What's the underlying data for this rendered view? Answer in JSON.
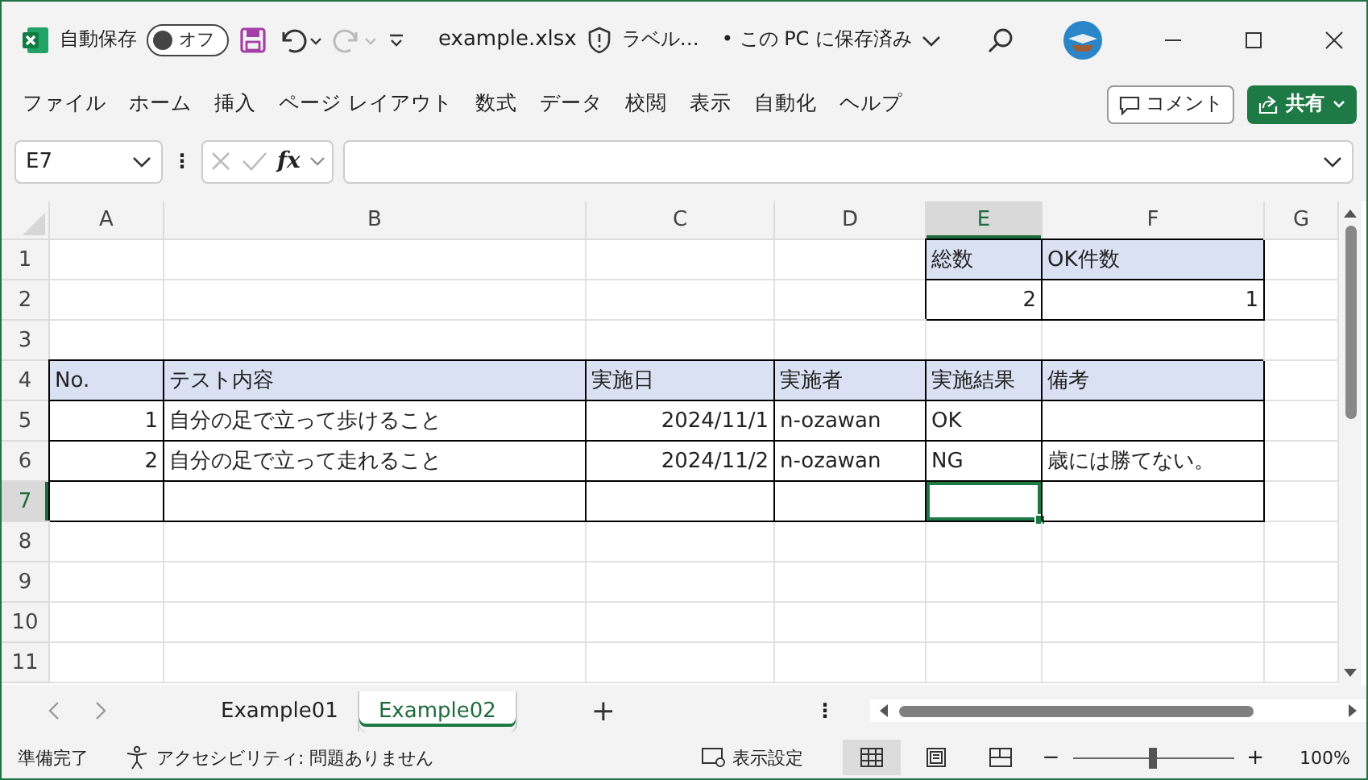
{
  "title_bar": {
    "autosave_label": "自動保存",
    "autosave": {
      "on": false,
      "label": "オフ"
    },
    "file_name": "example.xlsx",
    "label_text": "ラベル…",
    "save_state": "• この PC に保存済み"
  },
  "ribbon": {
    "tabs": [
      "ファイル",
      "ホーム",
      "挿入",
      "ページ レイアウト",
      "数式",
      "データ",
      "校閲",
      "表示",
      "自動化",
      "ヘルプ"
    ],
    "comment_button": "コメント",
    "share_button": "共有"
  },
  "formula_bar": {
    "name_box": "E7",
    "more": "⋮",
    "fx": "fx"
  },
  "columns": [
    {
      "label": "A",
      "selected": false
    },
    {
      "label": "B",
      "selected": false
    },
    {
      "label": "C",
      "selected": false
    },
    {
      "label": "D",
      "selected": false
    },
    {
      "label": "E",
      "selected": true
    },
    {
      "label": "F",
      "selected": false
    },
    {
      "label": "G",
      "selected": false
    }
  ],
  "rows": [
    {
      "label": "1",
      "selected": false,
      "cells": [
        {
          "kind": "blank"
        },
        {
          "kind": "blank"
        },
        {
          "kind": "blank"
        },
        {
          "kind": "blank"
        },
        {
          "kind": "header",
          "text": "総数"
        },
        {
          "kind": "header",
          "text": "OK件数"
        },
        {
          "kind": "blank"
        }
      ]
    },
    {
      "label": "2",
      "selected": false,
      "cells": [
        {
          "kind": "blank"
        },
        {
          "kind": "blank"
        },
        {
          "kind": "blank"
        },
        {
          "kind": "blank"
        },
        {
          "kind": "number",
          "text": "2"
        },
        {
          "kind": "number",
          "text": "1"
        },
        {
          "kind": "blank"
        }
      ]
    },
    {
      "label": "3",
      "selected": false
    },
    {
      "label": "4",
      "selected": false,
      "cells": [
        {
          "kind": "header",
          "text": "No."
        },
        {
          "kind": "header",
          "text": "テスト内容"
        },
        {
          "kind": "header",
          "text": "実施日"
        },
        {
          "kind": "header",
          "text": "実施者"
        },
        {
          "kind": "header",
          "text": "実施結果"
        },
        {
          "kind": "header",
          "text": "備考"
        },
        {
          "kind": "blank"
        }
      ]
    },
    {
      "label": "5",
      "selected": false,
      "cells": [
        {
          "kind": "number",
          "text": "1"
        },
        {
          "kind": "text",
          "text": "自分の足で立って歩けること"
        },
        {
          "kind": "number",
          "text": "2024/11/1"
        },
        {
          "kind": "text",
          "text": "n-ozawan"
        },
        {
          "kind": "text",
          "text": "OK"
        },
        {
          "kind": "empty"
        },
        {
          "kind": "blank"
        }
      ]
    },
    {
      "label": "6",
      "selected": false,
      "cells": [
        {
          "kind": "number",
          "text": "2"
        },
        {
          "kind": "text",
          "text": "自分の足で立って走れること"
        },
        {
          "kind": "number",
          "text": "2024/11/2"
        },
        {
          "kind": "text",
          "text": "n-ozawan"
        },
        {
          "kind": "text",
          "text": "NG"
        },
        {
          "kind": "text",
          "text": "歳には勝てない。"
        },
        {
          "kind": "blank"
        }
      ]
    },
    {
      "label": "7",
      "selected": true,
      "cells": [
        {
          "kind": "empty"
        },
        {
          "kind": "empty"
        },
        {
          "kind": "empty"
        },
        {
          "kind": "empty"
        },
        {
          "kind": "empty",
          "active": true
        },
        {
          "kind": "empty"
        },
        {
          "kind": "blank"
        }
      ]
    },
    {
      "label": "8",
      "selected": false
    },
    {
      "label": "9",
      "selected": false
    },
    {
      "label": "10",
      "selected": false
    },
    {
      "label": "11",
      "selected": false
    }
  ],
  "sheet_tabs": [
    {
      "label": "Example01",
      "selected": false
    },
    {
      "label": "Example02",
      "selected": true
    }
  ],
  "sheet_bar": {
    "add": "+",
    "more": "⋮"
  },
  "status_bar": {
    "ready": "準備完了",
    "accessibility": "アクセシビリティ: 問題ありません",
    "display_settings": "表示設定",
    "views": [
      {
        "kind": "normal",
        "selected": true
      },
      {
        "kind": "page-layout",
        "selected": false
      },
      {
        "kind": "page-break",
        "selected": false
      }
    ],
    "zoom_out": "−",
    "zoom_in": "+",
    "zoom": {
      "level": 0.5
    },
    "zoom_text": "100%"
  }
}
